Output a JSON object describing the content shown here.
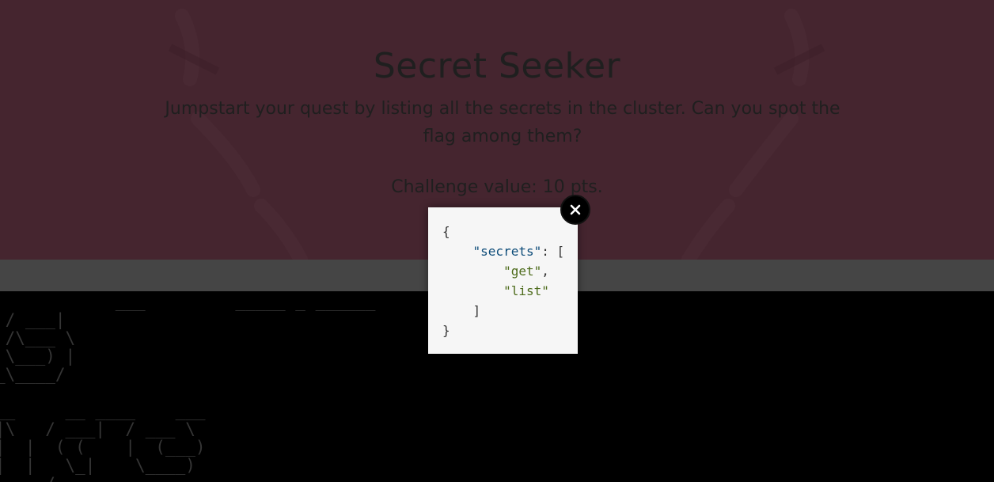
{
  "challenge": {
    "title": "Secret Seeker",
    "description": "Jumpstart your quest by listing all the secrets in the cluster. Can you spot the flag among them?",
    "value": "Challenge value: 10 pts."
  },
  "terminal": {
    "ascii_lines": [
      "            ___         _____ _ ______",
      " / ___|  ",
      " /\\___ \\ ",
      " \\___) |",
      "_\\____/ ",
      "",
      "__     __ ____    ___",
      "|\\   / ___|  / ___ \\",
      "|  |  ( (    |  (___)",
      "|  |   \\_|    \\____)",
      "     /"
    ]
  },
  "modal": {
    "code_lines": [
      {
        "indent": "",
        "parts": [
          {
            "t": "punct",
            "v": "{"
          }
        ]
      },
      {
        "indent": "    ",
        "parts": [
          {
            "t": "key",
            "v": "\"secrets\""
          },
          {
            "t": "punct",
            "v": ": ["
          }
        ]
      },
      {
        "indent": "        ",
        "parts": [
          {
            "t": "str",
            "v": "\"get\""
          },
          {
            "t": "punct",
            "v": ","
          }
        ]
      },
      {
        "indent": "        ",
        "parts": [
          {
            "t": "str",
            "v": "\"list\""
          }
        ]
      },
      {
        "indent": "    ",
        "parts": [
          {
            "t": "punct",
            "v": "]"
          }
        ]
      },
      {
        "indent": "",
        "parts": [
          {
            "t": "punct",
            "v": "}"
          }
        ]
      }
    ],
    "close_icon": "close-icon"
  },
  "colors": {
    "hero_background": "#8a4a5e",
    "overlay": "rgba(0,0,0,0.5)",
    "modal_background": "#f6f6f6",
    "json_key": "#0d4c79",
    "json_string": "#4d6b1b"
  }
}
